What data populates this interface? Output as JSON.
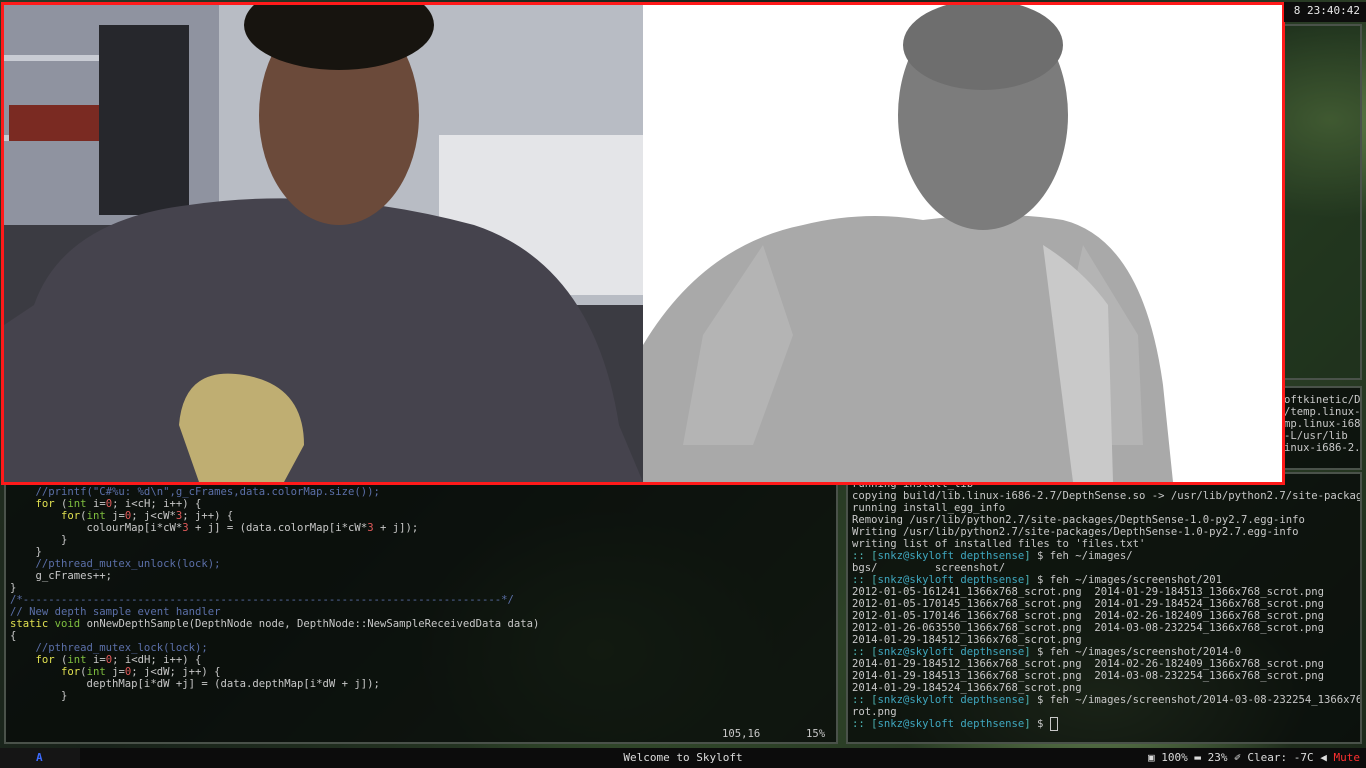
{
  "clock": "8 23:40:42",
  "taskbar": {
    "workspace": "A",
    "welcome": "Welcome to Skyloft",
    "brightness": "100%",
    "battery": "23%",
    "weather": "Clear: -7C",
    "volume": "Mute"
  },
  "editor": {
    "lines": [
      "    //printf(\"C#%u: %d\\n\",g_cFrames,data.colorMap.size());",
      "    for (int i=0; i<cH; i++) {",
      "        for(int j=0; j<cW*3; j++) {",
      "            colourMap[i*cW*3 + j] = (data.colorMap[i*cW*3 + j]);",
      "        }",
      "    }",
      "    //pthread_mutex_unlock(lock);",
      "    g_cFrames++;",
      "}",
      "",
      "/*---------------------------------------------------------------------------*/",
      "// New depth sample event handler",
      "static void onNewDepthSample(DepthNode node, DepthNode::NewSampleReceivedData data)",
      "{",
      "",
      "    //pthread_mutex_lock(lock);",
      "    for (int i=0; i<dH; i++) {",
      "        for(int j=0; j<dW; j++) {",
      "            depthMap[i*dW +j] = (data.depthMap[i*dW + j]);",
      "        }"
    ],
    "cursor_pos": "105,16",
    "scroll_pct": "15%"
  },
  "terminal": {
    "lines": [
      "running install_lib",
      "copying build/lib.linux-i686-2.7/DepthSense.so -> /usr/lib/python2.7/site-packages",
      "running install_egg_info",
      "Removing /usr/lib/python2.7/site-packages/DepthSense-1.0-py2.7.egg-info",
      "Writing /usr/lib/python2.7/site-packages/DepthSense-1.0-py2.7.egg-info",
      "writing list of installed files to 'files.txt'",
      ":: [snkz@skyloft depthsense] $ feh ~/images/",
      "bgs/         screenshot/",
      ":: [snkz@skyloft depthsense] $ feh ~/images/screenshot/201",
      "2012-01-05-161241_1366x768_scrot.png  2014-01-29-184513_1366x768_scrot.png",
      "2012-01-05-170145_1366x768_scrot.png  2014-01-29-184524_1366x768_scrot.png",
      "2012-01-05-170146_1366x768_scrot.png  2014-02-26-182409_1366x768_scrot.png",
      "2012-01-26-063550_1366x768_scrot.png  2014-03-08-232254_1366x768_scrot.png",
      "2014-01-29-184512_1366x768_scrot.png",
      ":: [snkz@skyloft depthsense] $ feh ~/images/screenshot/2014-0",
      "2014-01-29-184512_1366x768_scrot.png  2014-02-26-182409_1366x768_scrot.png",
      "2014-01-29-184513_1366x768_scrot.png  2014-03-08-232254_1366x768_scrot.png",
      "2014-01-29-184524_1366x768_scrot.png",
      ":: [snkz@skyloft depthsense] $ feh ~/images/screenshot/2014-03-08-232254_1366x768_sc",
      "rot.png",
      ":: [snkz@skyloft depthsense] $ "
    ]
  },
  "side_terminal": {
    "lines": [
      "oftkinetic/D",
      "/temp.linux-",
      "",
      "mp.linux-i68",
      "-L/usr/lib",
      "inux-i686-2.7"
    ]
  }
}
